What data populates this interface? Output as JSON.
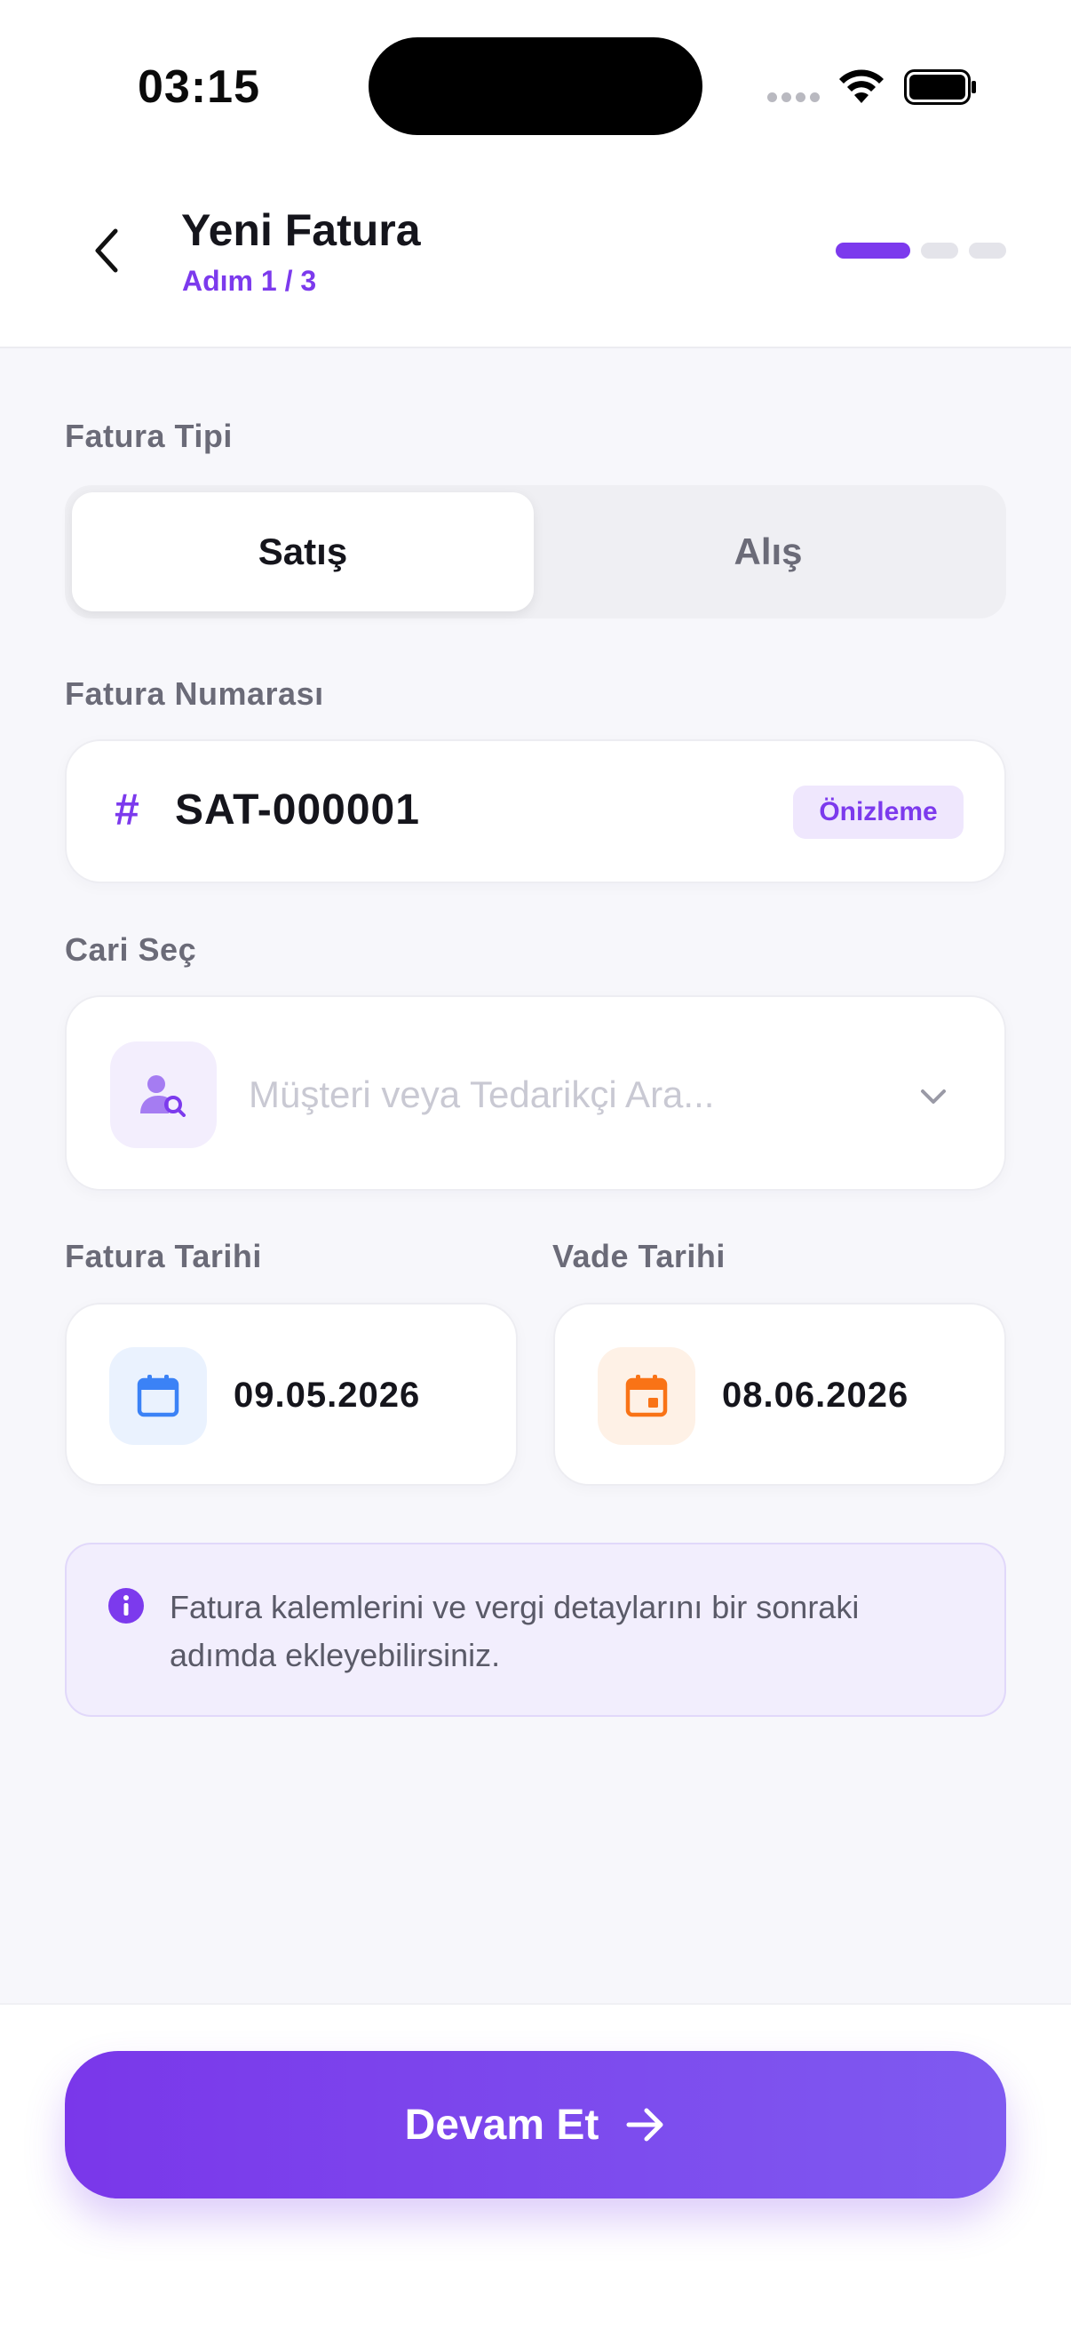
{
  "status": {
    "time": "03:15"
  },
  "header": {
    "title": "Yeni Fatura",
    "step": "Adım 1 / 3"
  },
  "invoice_type": {
    "label": "Fatura Tipi",
    "options": [
      "Satış",
      "Alış"
    ],
    "selected": "Satış"
  },
  "invoice_number": {
    "label": "Fatura Numarası",
    "value": "SAT-000001",
    "badge": "Önizleme",
    "prefix_icon": "hash-icon"
  },
  "contact": {
    "label": "Cari Seç",
    "placeholder": "Müşteri veya Tedarikçi Ara..."
  },
  "invoice_date": {
    "label": "Fatura Tarihi",
    "value": "09.05.2026"
  },
  "due_date": {
    "label": "Vade Tarihi",
    "value": "08.06.2026"
  },
  "info": {
    "text": "Fatura kalemlerini ve vergi detaylarını bir sonraki adımda ekleyebilirsiniz."
  },
  "footer": {
    "cta": "Devam Et"
  },
  "colors": {
    "accent": "#7c3aed",
    "blue": "#3b82f6",
    "orange": "#f97316"
  },
  "progress": {
    "current_step": 1,
    "total_steps": 3
  }
}
